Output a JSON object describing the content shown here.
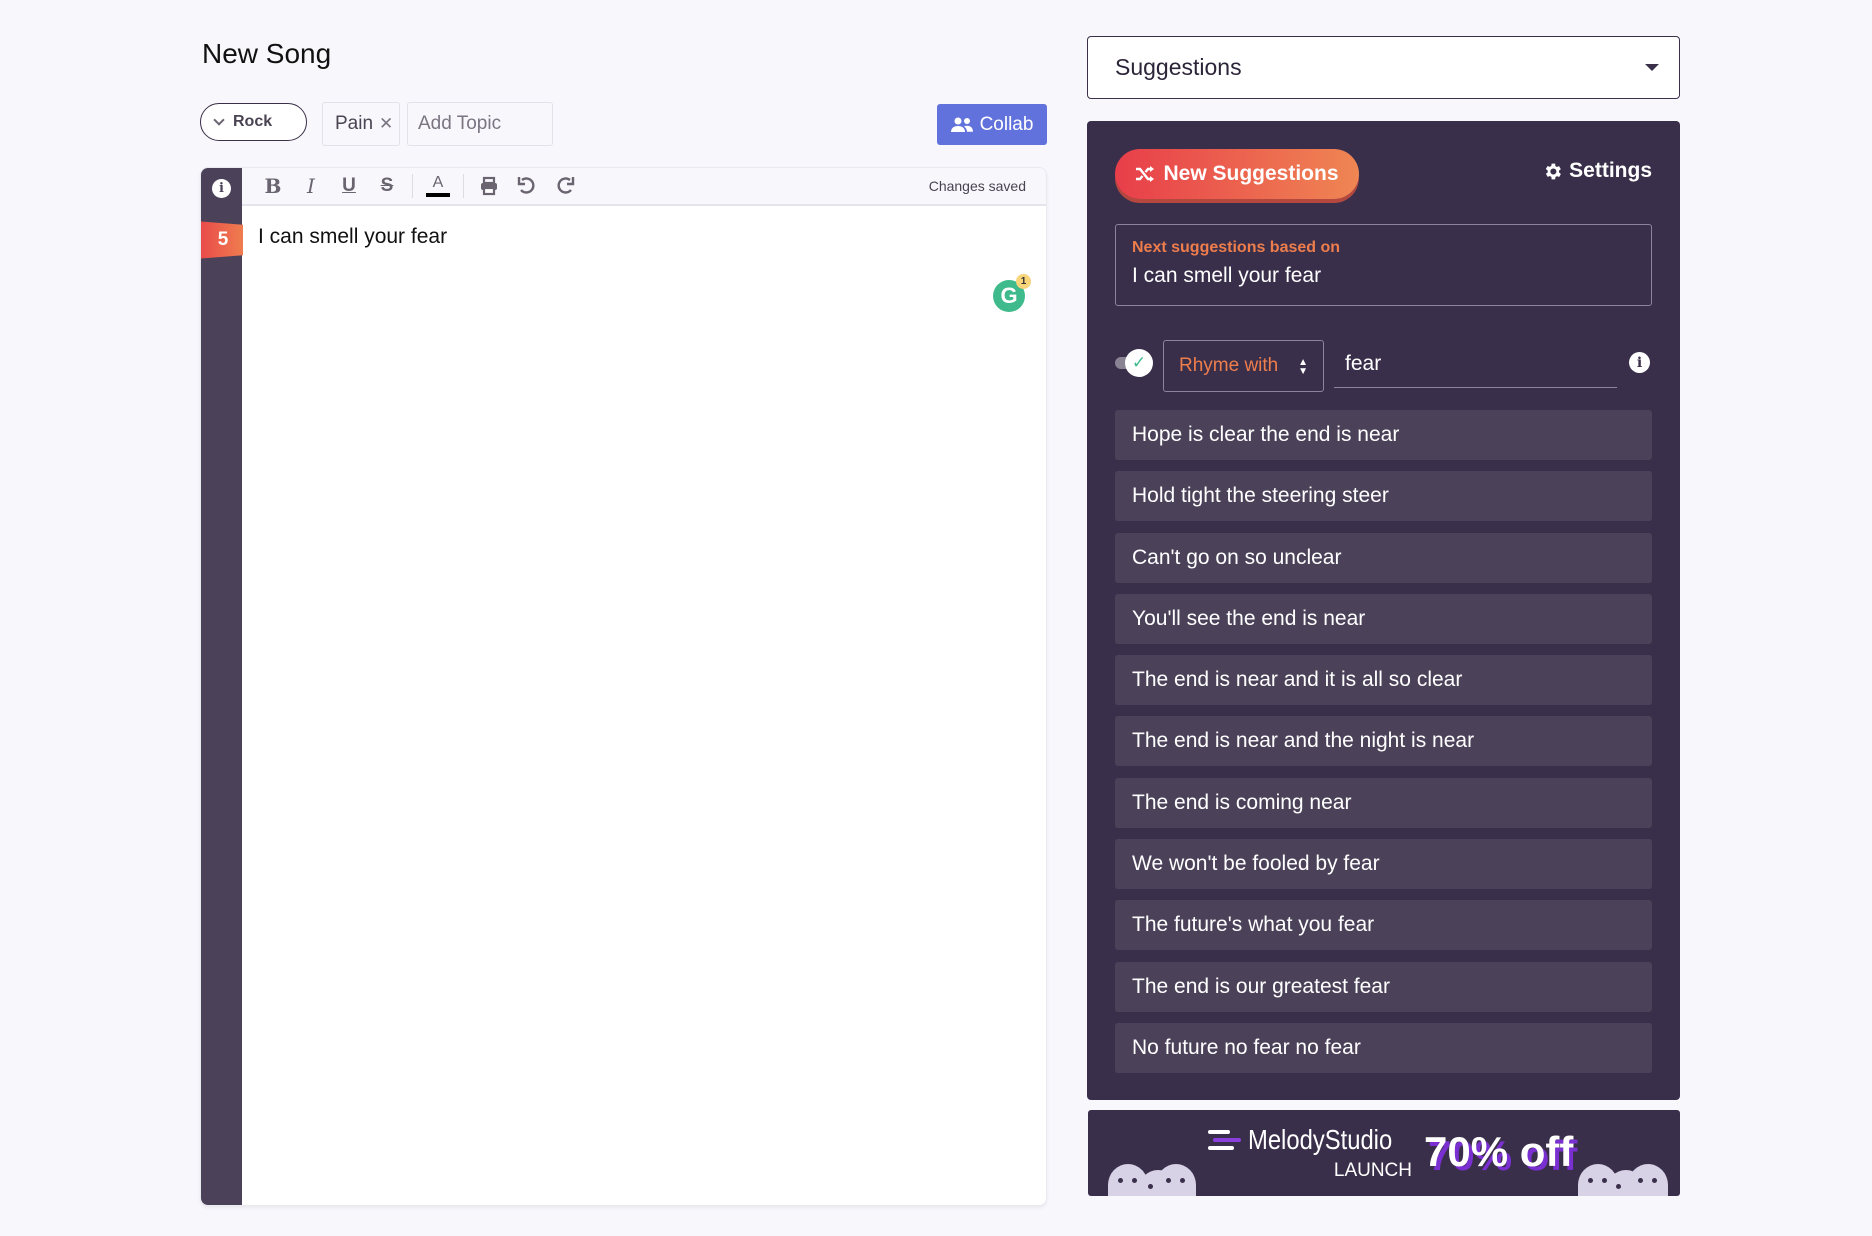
{
  "header": {
    "title": "New Song",
    "genre": "Rock",
    "topics": [
      "Pain"
    ],
    "add_topic_placeholder": "Add Topic",
    "collab_label": "Collab"
  },
  "editor": {
    "toolbar": {
      "items": [
        "bold-icon",
        "italic-icon",
        "underline-icon",
        "strikethrough-icon",
        "text-color-icon",
        "print-icon",
        "undo-icon",
        "redo-icon"
      ],
      "status": "Changes saved"
    },
    "line_syllables": "5",
    "lines": [
      "I can smell your fear"
    ],
    "grammarly_count": "1",
    "grammarly_letter": "G"
  },
  "suggestions_panel": {
    "dropdown_value": "Suggestions",
    "new_suggestions_label": "New Suggestions",
    "settings_label": "Settings",
    "based_on_label": "Next suggestions based on",
    "based_on_value": "I can smell your fear",
    "rhyme_toggle_on": true,
    "rhyme_mode": "Rhyme with",
    "rhyme_word": "fear",
    "items": [
      "Hope is clear the end is near",
      "Hold tight the steering steer",
      "Can't go on so unclear",
      "You'll see the end is near",
      "The end is near and it is all so clear",
      "The end is near and the night is near",
      "The end is coming near",
      "We won't be fooled by fear",
      "The future's what you fear",
      "The end is our greatest fear",
      "No future no fear no fear"
    ]
  },
  "banner": {
    "brand": "MelodyStudio",
    "subtitle": "LAUNCH",
    "offer": "70% off"
  },
  "colors": {
    "panel_bg": "#3a2f4a",
    "item_bg": "#4b4259",
    "accent_orange": "#ee7d4c",
    "accent_red": "#e83e4a",
    "collab_blue": "#6272dd",
    "page_bg": "#f8f7fc"
  }
}
